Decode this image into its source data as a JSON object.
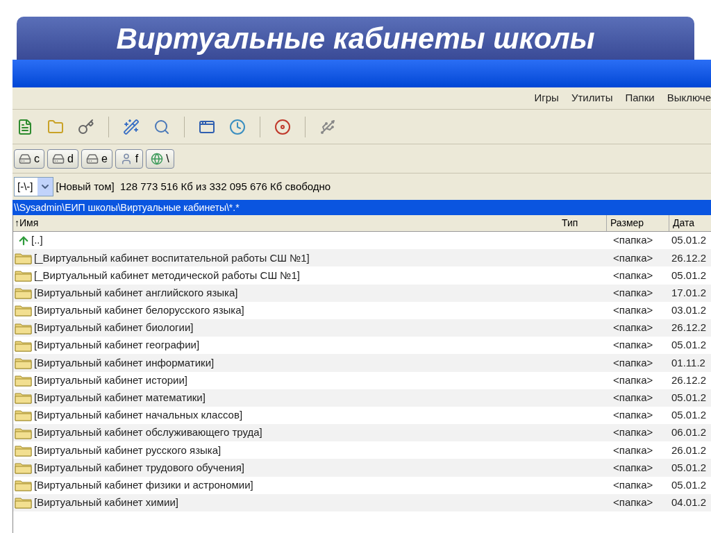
{
  "slide_title": "Виртуальные кабинеты школы",
  "menu": [
    "Игры",
    "Утилиты",
    "Папки",
    "Выключе"
  ],
  "toolbar": [
    {
      "kind": "document"
    },
    {
      "kind": "folder"
    },
    {
      "kind": "key"
    },
    {
      "kind": "wand"
    },
    {
      "kind": "magnifier"
    },
    {
      "kind": "window"
    },
    {
      "kind": "clock"
    },
    {
      "kind": "disc"
    },
    {
      "kind": "usb"
    }
  ],
  "drives": [
    {
      "letter": "c",
      "kind": "disk"
    },
    {
      "letter": "d",
      "kind": "disk"
    },
    {
      "letter": "e",
      "kind": "disk"
    },
    {
      "letter": "f",
      "kind": "removable"
    },
    {
      "letter": "\\",
      "kind": "network"
    }
  ],
  "drive_select": {
    "value": "[-\\-]"
  },
  "volume_info": "[Новый том]  128 773 516 Кб из 332 095 676 Кб свободно",
  "path": "\\\\Sysadmin\\ЕИП школы\\Виртуальные кабинеты\\*.*",
  "columns": [
    "↑Имя",
    "Тип",
    "Размер",
    "Дата"
  ],
  "rows": [
    {
      "kind": "up",
      "name": "[..]",
      "size": "<папка>",
      "date": "05.01.2"
    },
    {
      "kind": "folder",
      "name": "[_Виртуальный кабинет воспитательной работы СШ №1]",
      "size": "<папка>",
      "date": "26.12.2"
    },
    {
      "kind": "folder",
      "name": "[_Виртуальный кабинет методической работы СШ №1]",
      "size": "<папка>",
      "date": "05.01.2"
    },
    {
      "kind": "folder",
      "name": "[Виртуальный кабинет английского языка]",
      "size": "<папка>",
      "date": "17.01.2"
    },
    {
      "kind": "folder",
      "name": "[Виртуальный кабинет белорусского языка]",
      "size": "<папка>",
      "date": "03.01.2"
    },
    {
      "kind": "folder",
      "name": "[Виртуальный кабинет биологии]",
      "size": "<папка>",
      "date": "26.12.2"
    },
    {
      "kind": "folder",
      "name": "[Виртуальный кабинет географии]",
      "size": "<папка>",
      "date": "05.01.2"
    },
    {
      "kind": "folder",
      "name": "[Виртуальный кабинет информатики]",
      "size": "<папка>",
      "date": "01.11.2"
    },
    {
      "kind": "folder",
      "name": "[Виртуальный кабинет истории]",
      "size": "<папка>",
      "date": "26.12.2"
    },
    {
      "kind": "folder",
      "name": "[Виртуальный кабинет математики]",
      "size": "<папка>",
      "date": "05.01.2"
    },
    {
      "kind": "folder",
      "name": "[Виртуальный кабинет начальных классов]",
      "size": "<папка>",
      "date": "05.01.2"
    },
    {
      "kind": "folder",
      "name": "[Виртуальный кабинет обслуживающего труда]",
      "size": "<папка>",
      "date": "06.01.2"
    },
    {
      "kind": "folder",
      "name": "[Виртуальный кабинет русского языка]",
      "size": "<папка>",
      "date": "26.01.2"
    },
    {
      "kind": "folder",
      "name": "[Виртуальный кабинет трудового обучения]",
      "size": "<папка>",
      "date": "05.01.2"
    },
    {
      "kind": "folder",
      "name": "[Виртуальный кабинет физики и астрономии]",
      "size": "<папка>",
      "date": "05.01.2"
    },
    {
      "kind": "folder",
      "name": "[Виртуальный кабинет химии]",
      "size": "<папка>",
      "date": "04.01.2"
    }
  ]
}
